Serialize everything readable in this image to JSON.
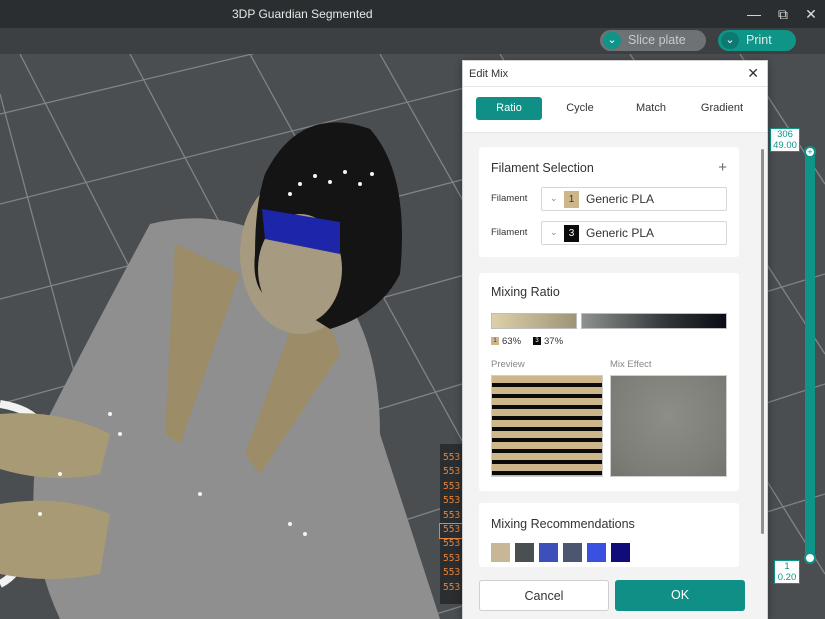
{
  "window": {
    "title": "3DP Guardian Segmented",
    "minimize_icon": "minimize-icon",
    "restore_icon": "restore-icon",
    "close_icon": "close-icon"
  },
  "toolbar": {
    "slice_label": "Slice plate",
    "print_label": "Print"
  },
  "layer_list": [
    "553",
    "553",
    "553",
    "553",
    "553",
    "553",
    "553",
    "553",
    "553",
    "553"
  ],
  "layer_slider": {
    "top_layer": "306",
    "top_height": "49.00",
    "bottom_layer": "1",
    "bottom_height": "0.20"
  },
  "dialog": {
    "title": "Edit Mix",
    "tabs": [
      "Ratio",
      "Cycle",
      "Match",
      "Gradient"
    ],
    "active_tab": "Ratio",
    "filament_selection": {
      "heading": "Filament Selection",
      "add_icon": "plus-icon",
      "rows": [
        {
          "label": "Filament",
          "index": "1",
          "name": "Generic PLA",
          "color": "#cdb78a"
        },
        {
          "label": "Filament",
          "index": "3",
          "name": "Generic PLA",
          "color": "#0a0a0a"
        }
      ]
    },
    "mixing_ratio": {
      "heading": "Mixing Ratio",
      "first": {
        "index": "1",
        "percent": "63%",
        "value": 63,
        "color": "#cdb78a"
      },
      "second": {
        "index": "3",
        "percent": "37%",
        "value": 37,
        "color": "#0a0a0a"
      },
      "preview_label": "Preview",
      "mix_effect_label": "Mix Effect",
      "mix_color": "#84857e"
    },
    "mixing_recommendations": {
      "heading": "Mixing Recommendations",
      "swatches": [
        "#c7b796",
        "#4a4f52",
        "#3d4fb8",
        "#4b5670",
        "#3a50e0",
        "#100c7a"
      ]
    },
    "cancel_label": "Cancel",
    "ok_label": "OK"
  },
  "colors": {
    "accent": "#0f8f85"
  }
}
